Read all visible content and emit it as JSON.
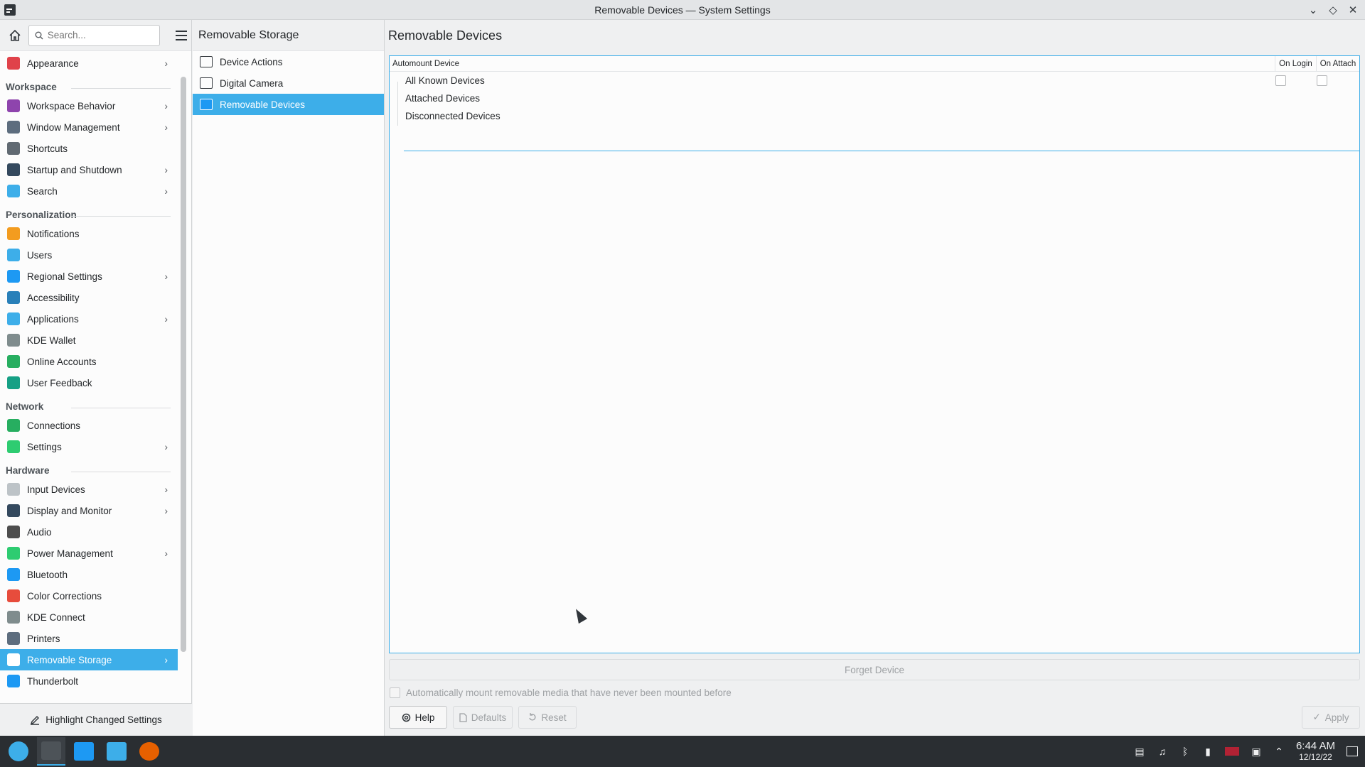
{
  "window": {
    "title": "Removable Devices — System Settings"
  },
  "sidebar": {
    "search_placeholder": "Search...",
    "items": [
      {
        "type": "item",
        "label": "Appearance",
        "icon": "appearance-icon",
        "color": "#e0424a",
        "chevron": true
      },
      {
        "type": "section",
        "label": "Workspace"
      },
      {
        "type": "item",
        "label": "Workspace Behavior",
        "icon": "workspace-behavior-icon",
        "color": "#8e44ad",
        "chevron": true
      },
      {
        "type": "item",
        "label": "Window Management",
        "icon": "window-management-icon",
        "color": "#5d6d7e",
        "chevron": true
      },
      {
        "type": "item",
        "label": "Shortcuts",
        "icon": "keyboard-icon",
        "color": "#616a72",
        "chevron": false
      },
      {
        "type": "item",
        "label": "Startup and Shutdown",
        "icon": "startup-icon",
        "color": "#34495e",
        "chevron": true
      },
      {
        "type": "item",
        "label": "Search",
        "icon": "search-icon",
        "color": "#3daee9",
        "chevron": true
      },
      {
        "type": "section",
        "label": "Personalization"
      },
      {
        "type": "item",
        "label": "Notifications",
        "icon": "bell-icon",
        "color": "#f39c1f",
        "chevron": false
      },
      {
        "type": "item",
        "label": "Users",
        "icon": "users-icon",
        "color": "#3daee9",
        "chevron": false
      },
      {
        "type": "item",
        "label": "Regional Settings",
        "icon": "regional-icon",
        "color": "#1d99f3",
        "chevron": true
      },
      {
        "type": "item",
        "label": "Accessibility",
        "icon": "accessibility-icon",
        "color": "#2980b9",
        "chevron": false
      },
      {
        "type": "item",
        "label": "Applications",
        "icon": "applications-icon",
        "color": "#3daee9",
        "chevron": true
      },
      {
        "type": "item",
        "label": "KDE Wallet",
        "icon": "wallet-icon",
        "color": "#7f8c8d",
        "chevron": false
      },
      {
        "type": "item",
        "label": "Online Accounts",
        "icon": "online-accounts-icon",
        "color": "#27ae60",
        "chevron": false
      },
      {
        "type": "item",
        "label": "User Feedback",
        "icon": "feedback-icon",
        "color": "#16a085",
        "chevron": false
      },
      {
        "type": "section",
        "label": "Network"
      },
      {
        "type": "item",
        "label": "Connections",
        "icon": "globe-icon",
        "color": "#27ae60",
        "chevron": false
      },
      {
        "type": "item",
        "label": "Settings",
        "icon": "network-settings-icon",
        "color": "#2ecc71",
        "chevron": true
      },
      {
        "type": "section",
        "label": "Hardware"
      },
      {
        "type": "item",
        "label": "Input Devices",
        "icon": "mouse-icon",
        "color": "#bdc3c7",
        "chevron": true
      },
      {
        "type": "item",
        "label": "Display and Monitor",
        "icon": "monitor-icon",
        "color": "#34495e",
        "chevron": true
      },
      {
        "type": "item",
        "label": "Audio",
        "icon": "speaker-icon",
        "color": "#4d4d4d",
        "chevron": false
      },
      {
        "type": "item",
        "label": "Power Management",
        "icon": "power-icon",
        "color": "#2ecc71",
        "chevron": true
      },
      {
        "type": "item",
        "label": "Bluetooth",
        "icon": "bluetooth-icon",
        "color": "#1d99f3",
        "chevron": false
      },
      {
        "type": "item",
        "label": "Color Corrections",
        "icon": "color-icon",
        "color": "#e74c3c",
        "chevron": false
      },
      {
        "type": "item",
        "label": "KDE Connect",
        "icon": "phone-icon",
        "color": "#7f8c8d",
        "chevron": false
      },
      {
        "type": "item",
        "label": "Printers",
        "icon": "printer-icon",
        "color": "#5d6d7e",
        "chevron": false
      },
      {
        "type": "item",
        "label": "Removable Storage",
        "icon": "usb-icon",
        "color": "#ffffff",
        "chevron": true,
        "active": true
      },
      {
        "type": "item",
        "label": "Thunderbolt",
        "icon": "thunderbolt-icon",
        "color": "#1d99f3",
        "chevron": false
      }
    ],
    "highlight_label": "Highlight Changed Settings"
  },
  "midcol": {
    "title": "Removable Storage",
    "items": [
      {
        "label": "Device Actions",
        "icon": "play-icon",
        "active": false
      },
      {
        "label": "Digital Camera",
        "icon": "camera-icon",
        "active": false
      },
      {
        "label": "Removable Devices",
        "icon": "usb-icon",
        "active": true
      }
    ]
  },
  "main": {
    "title": "Removable Devices",
    "table": {
      "columns": [
        "Automount Device",
        "On Login",
        "On Attach"
      ],
      "rows": [
        {
          "label": "All Known Devices",
          "checkboxes": true
        },
        {
          "label": "Attached Devices",
          "checkboxes": false
        },
        {
          "label": "Disconnected Devices",
          "checkboxes": false
        }
      ]
    },
    "forget_label": "Forget Device",
    "automount_label": "Automatically mount removable media that have never been mounted before",
    "buttons": {
      "help": "Help",
      "defaults": "Defaults",
      "reset": "Reset",
      "apply": "Apply"
    }
  },
  "taskbar": {
    "time": "6:44 AM",
    "date": "12/12/22"
  },
  "colors": {
    "accent": "#3daee9",
    "panel": "#2a2e32"
  }
}
